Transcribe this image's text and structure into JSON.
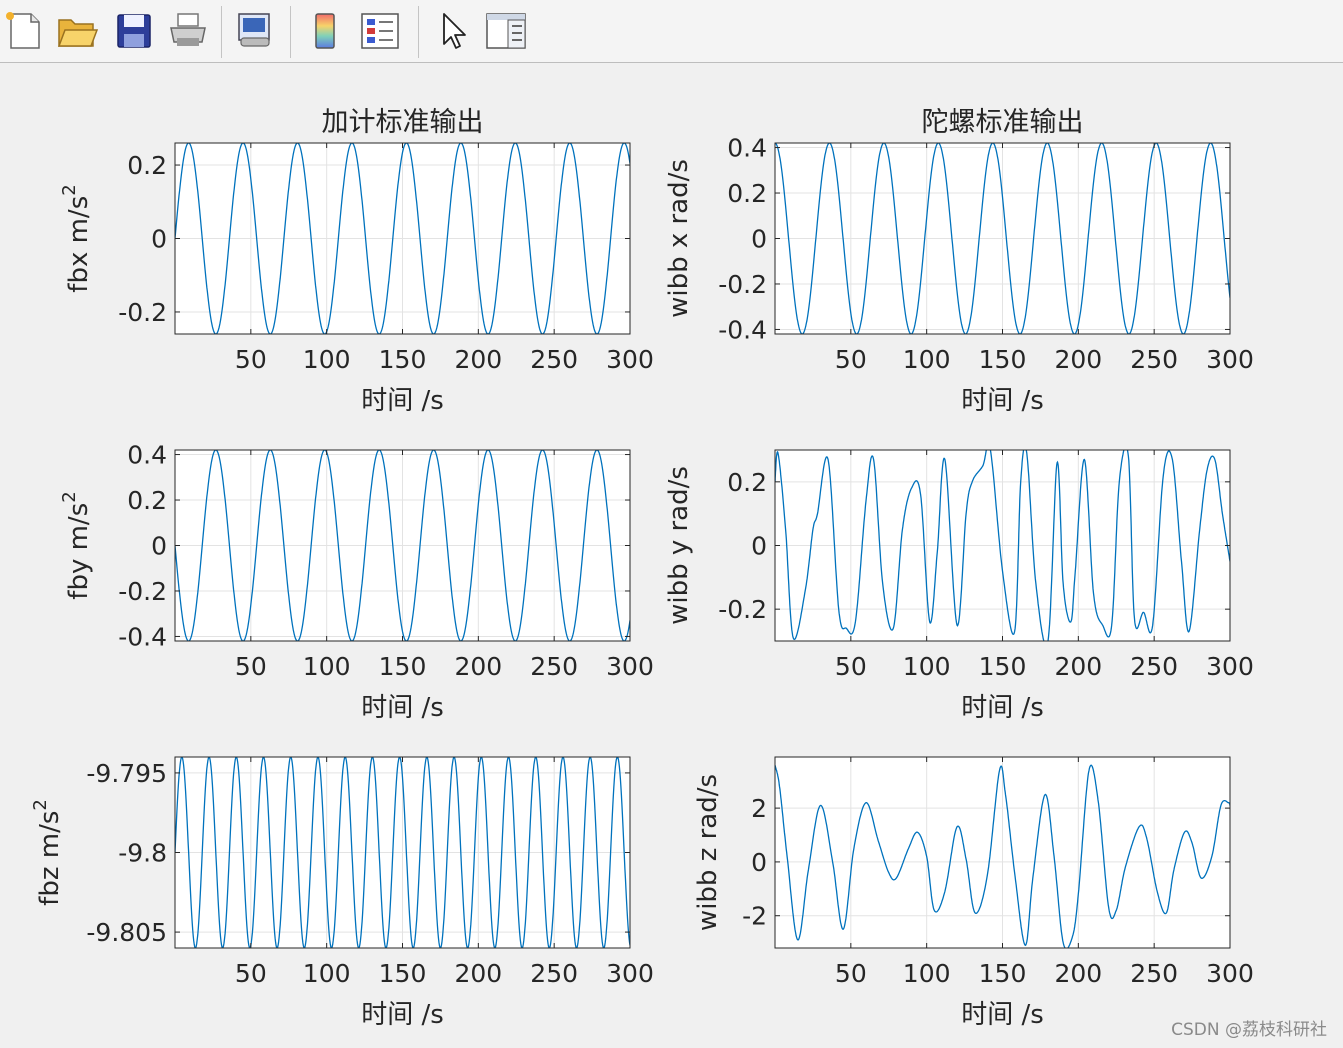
{
  "toolbar": {
    "buttons": [
      {
        "name": "new-figure-icon"
      },
      {
        "name": "open-file-icon"
      },
      {
        "name": "save-icon"
      },
      {
        "name": "print-icon"
      },
      {
        "name": "print-preview-icon"
      },
      {
        "name": "colorbar-icon"
      },
      {
        "name": "legend-icon"
      },
      {
        "name": "pointer-icon"
      },
      {
        "name": "property-editor-icon"
      }
    ]
  },
  "watermark": "CSDN @荔枝科研社",
  "style": {
    "line_color": "#0072bd",
    "axes_bg": "#ffffff",
    "grid_color": "#e3e3e3",
    "text_color": "#262626"
  },
  "chart_data": [
    {
      "type": "line",
      "title": "加计标准输出",
      "xlabel": "时间 /s",
      "ylabel": [
        "fbx m/s",
        "2"
      ],
      "xlim": [
        0,
        300
      ],
      "ylim": [
        -0.26,
        0.26
      ],
      "xticks": [
        50,
        100,
        150,
        200,
        250,
        300
      ],
      "xtick_labels": [
        "50",
        "100",
        "150",
        "200",
        "250",
        "300"
      ],
      "yticks": [
        -0.2,
        0,
        0.2
      ],
      "ytick_labels": [
        "-0.2",
        "0",
        "0.2"
      ],
      "grid": true,
      "series": [
        {
          "amplitude": 0.26,
          "period": 35.9,
          "phase": 0,
          "offset": 0,
          "x": [
            0,
            10,
            20,
            30,
            40,
            50,
            60,
            70,
            80,
            90,
            100,
            110,
            120,
            130,
            140,
            150,
            160,
            170,
            180,
            190,
            200,
            210,
            220,
            230,
            240,
            250,
            260,
            270,
            280,
            290,
            300
          ],
          "y": [
            0,
            0.254,
            0.117,
            -0.2,
            -0.227,
            0.049,
            0.26,
            0.155,
            -0.155,
            -0.26,
            -0.049,
            0.227,
            0.2,
            -0.117,
            -0.254,
            0,
            0.254,
            0.117,
            -0.2,
            -0.227,
            0.049,
            0.26,
            0.155,
            -0.155,
            -0.26,
            -0.049,
            0.227,
            0.2,
            -0.117,
            -0.254,
            0
          ]
        }
      ]
    },
    {
      "type": "line",
      "title": "陀螺标准输出",
      "xlabel": "时间 /s",
      "ylabel": [
        "wibb x rad/s"
      ],
      "xlim": [
        0,
        300
      ],
      "ylim": [
        -0.42,
        0.42
      ],
      "xticks": [
        50,
        100,
        150,
        200,
        250,
        300
      ],
      "xtick_labels": [
        "50",
        "100",
        "150",
        "200",
        "250",
        "300"
      ],
      "yticks": [
        -0.4,
        -0.2,
        0,
        0.2,
        0.4
      ],
      "ytick_labels": [
        "-0.4",
        "-0.2",
        "0",
        "0.2",
        "0.4"
      ],
      "grid": true,
      "series": [
        {
          "amplitude": 0.42,
          "period": 35.9,
          "phase": 1.5708,
          "offset": 0,
          "x": [
            0,
            10,
            20,
            30,
            40,
            50,
            60,
            70,
            80,
            90,
            100,
            110,
            120,
            130,
            140,
            150,
            160,
            170,
            180,
            190,
            200,
            210,
            220,
            230,
            240,
            250,
            260,
            270,
            280,
            290,
            300
          ],
          "y": [
            0.42,
            0.059,
            -0.397,
            -0.135,
            0.366,
            0.408,
            -0.079,
            -0.42,
            -0.079,
            0.408,
            0.366,
            -0.135,
            -0.397,
            0.059,
            0.42,
            0,
            -0.42,
            -0.059,
            0.397,
            0.135,
            -0.366,
            -0.408,
            0.079,
            0.42,
            0.079,
            -0.408,
            -0.366,
            0.135,
            0.397,
            -0.059,
            -0.23
          ]
        }
      ]
    },
    {
      "type": "line",
      "title": "",
      "xlabel": "时间 /s",
      "ylabel": [
        "fby m/s",
        "2"
      ],
      "xlim": [
        0,
        300
      ],
      "ylim": [
        -0.42,
        0.42
      ],
      "xticks": [
        50,
        100,
        150,
        200,
        250,
        300
      ],
      "xtick_labels": [
        "50",
        "100",
        "150",
        "200",
        "250",
        "300"
      ],
      "yticks": [
        -0.4,
        -0.2,
        0,
        0.2,
        0.4
      ],
      "ytick_labels": [
        "-0.4",
        "-0.2",
        "0",
        "0.2",
        "0.4"
      ],
      "grid": true,
      "series": [
        {
          "amplitude": 0.42,
          "period": 35.9,
          "phase": 3.1416,
          "offset": 0,
          "x": [
            0,
            10,
            20,
            30,
            40,
            50,
            60,
            70,
            80,
            90,
            100,
            110,
            120,
            130,
            140,
            150,
            160,
            170,
            180,
            190,
            200,
            210,
            220,
            230,
            240,
            250,
            260,
            270,
            280,
            290,
            300
          ],
          "y": [
            0,
            -0.41,
            -0.19,
            0.32,
            0.37,
            -0.08,
            -0.42,
            -0.25,
            0.25,
            0.42,
            0.08,
            -0.37,
            -0.32,
            0.19,
            0.41,
            0,
            -0.41,
            -0.19,
            0.32,
            0.37,
            -0.08,
            -0.42,
            -0.25,
            0.25,
            0.42,
            0.08,
            -0.37,
            -0.32,
            0.19,
            0.41,
            -0.38
          ]
        }
      ]
    },
    {
      "type": "line",
      "title": "",
      "xlabel": "时间 /s",
      "ylabel": [
        "wibb y rad/s"
      ],
      "xlim": [
        0,
        300
      ],
      "ylim": [
        -0.3,
        0.3
      ],
      "xticks": [
        50,
        100,
        150,
        200,
        250,
        300
      ],
      "xtick_labels": [
        "50",
        "100",
        "150",
        "200",
        "250",
        "300"
      ],
      "yticks": [
        -0.2,
        0,
        0.2
      ],
      "ytick_labels": [
        "-0.2",
        "0",
        "0.2"
      ],
      "grid": true,
      "series": [
        {
          "x": [
            0,
            2,
            7,
            12,
            20,
            25,
            28,
            35,
            42,
            47,
            53,
            60,
            65,
            71,
            78,
            84,
            90,
            96,
            102,
            107,
            112,
            120,
            126,
            130,
            137,
            142,
            150,
            158,
            162,
            166,
            172,
            180,
            186,
            190,
            195,
            198,
            204,
            210,
            216,
            222,
            227,
            233,
            237,
            243,
            249,
            256,
            262,
            268,
            273,
            280,
            285,
            290,
            295,
            300
          ],
          "y": [
            0.2,
            0.29,
            0.05,
            -0.29,
            -0.14,
            0.05,
            0.1,
            0.27,
            -0.2,
            -0.26,
            -0.24,
            0.14,
            0.27,
            -0.12,
            -0.26,
            0.05,
            0.18,
            0.16,
            -0.24,
            -0.02,
            0.27,
            -0.25,
            0.1,
            0.2,
            0.25,
            0.3,
            -0.08,
            -0.27,
            0.2,
            0.29,
            -0.12,
            -0.3,
            0.26,
            -0.12,
            -0.24,
            -0.08,
            0.27,
            -0.15,
            -0.25,
            -0.25,
            0.2,
            0.28,
            -0.23,
            -0.21,
            -0.25,
            0.22,
            0.27,
            -0.05,
            -0.27,
            0.05,
            0.24,
            0.27,
            0.1,
            -0.05
          ]
        }
      ]
    },
    {
      "type": "line",
      "title": "",
      "xlabel": "时间 /s",
      "ylabel": [
        "fbz m/s",
        "2"
      ],
      "xlim": [
        0,
        300
      ],
      "ylim": [
        -9.806,
        -9.794
      ],
      "xticks": [
        50,
        100,
        150,
        200,
        250,
        300
      ],
      "xtick_labels": [
        "50",
        "100",
        "150",
        "200",
        "250",
        "300"
      ],
      "yticks": [
        -9.805,
        -9.8,
        -9.795
      ],
      "ytick_labels": [
        "-9.805",
        "-9.8",
        "-9.795"
      ],
      "grid": true,
      "series": [
        {
          "amplitude": 0.006,
          "period": 17.95,
          "phase": 0,
          "offset": -9.8,
          "x": [
            0,
            10,
            20,
            30,
            40,
            50,
            60,
            70,
            80,
            90,
            100,
            110,
            120,
            130,
            140,
            150,
            160,
            170,
            180,
            190,
            200,
            210,
            220,
            230,
            240,
            250,
            260,
            270,
            280,
            290,
            300
          ],
          "y": [
            -9.8,
            -9.8019,
            -9.7956,
            -9.8052,
            -9.7945,
            -9.8051,
            -9.796,
            -9.8032,
            -9.7975,
            -9.8015,
            -9.7993,
            -9.7999,
            -9.8009,
            -9.7984,
            -9.8023,
            -9.7972,
            -9.8044,
            -9.795,
            -9.8058,
            -9.7941,
            -9.8059,
            -9.7951,
            -9.8044,
            -9.7966,
            -9.803,
            -9.798,
            -9.8016,
            -9.7994,
            -9.8002,
            -9.801,
            -9.7958
          ]
        }
      ]
    },
    {
      "type": "line",
      "title": "",
      "xlabel": "时间 /s",
      "ylabel": [
        "wibb z rad/s"
      ],
      "xlim": [
        0,
        300
      ],
      "ylim": [
        -3.2,
        3.9
      ],
      "xticks": [
        50,
        100,
        150,
        200,
        250,
        300
      ],
      "xtick_labels": [
        "50",
        "100",
        "150",
        "200",
        "250",
        "300"
      ],
      "yticks": [
        -2,
        0,
        2
      ],
      "ytick_labels": [
        "-2",
        "0",
        "2"
      ],
      "grid": true,
      "series": [
        {
          "x": [
            0,
            3,
            8,
            15,
            22,
            30,
            38,
            45,
            52,
            60,
            68,
            75,
            80,
            88,
            94,
            100,
            105,
            112,
            120,
            126,
            132,
            140,
            148,
            152,
            158,
            165,
            170,
            178,
            184,
            190,
            196,
            200,
            207,
            213,
            220,
            225,
            231,
            240,
            245,
            252,
            258,
            263,
            270,
            275,
            281,
            288,
            294,
            299,
            300
          ],
          "y": [
            3.6,
            2.8,
            0.2,
            -2.9,
            -0.3,
            2.1,
            0,
            -2.5,
            0.5,
            2.2,
            0.8,
            -0.4,
            -0.6,
            0.5,
            1.1,
            0.2,
            -1.8,
            -1.1,
            1.3,
            0.1,
            -1.9,
            -0.5,
            3.4,
            2.5,
            -0.4,
            -3.1,
            -0.6,
            2.5,
            0.2,
            -3,
            -2.8,
            -1.2,
            3.4,
            2.3,
            -1.7,
            -1.8,
            -0.2,
            1.3,
            0.9,
            -1.1,
            -1.9,
            -0.3,
            1.1,
            0.7,
            -0.6,
            0.2,
            2.1,
            2.2,
            2.1
          ]
        }
      ]
    }
  ]
}
